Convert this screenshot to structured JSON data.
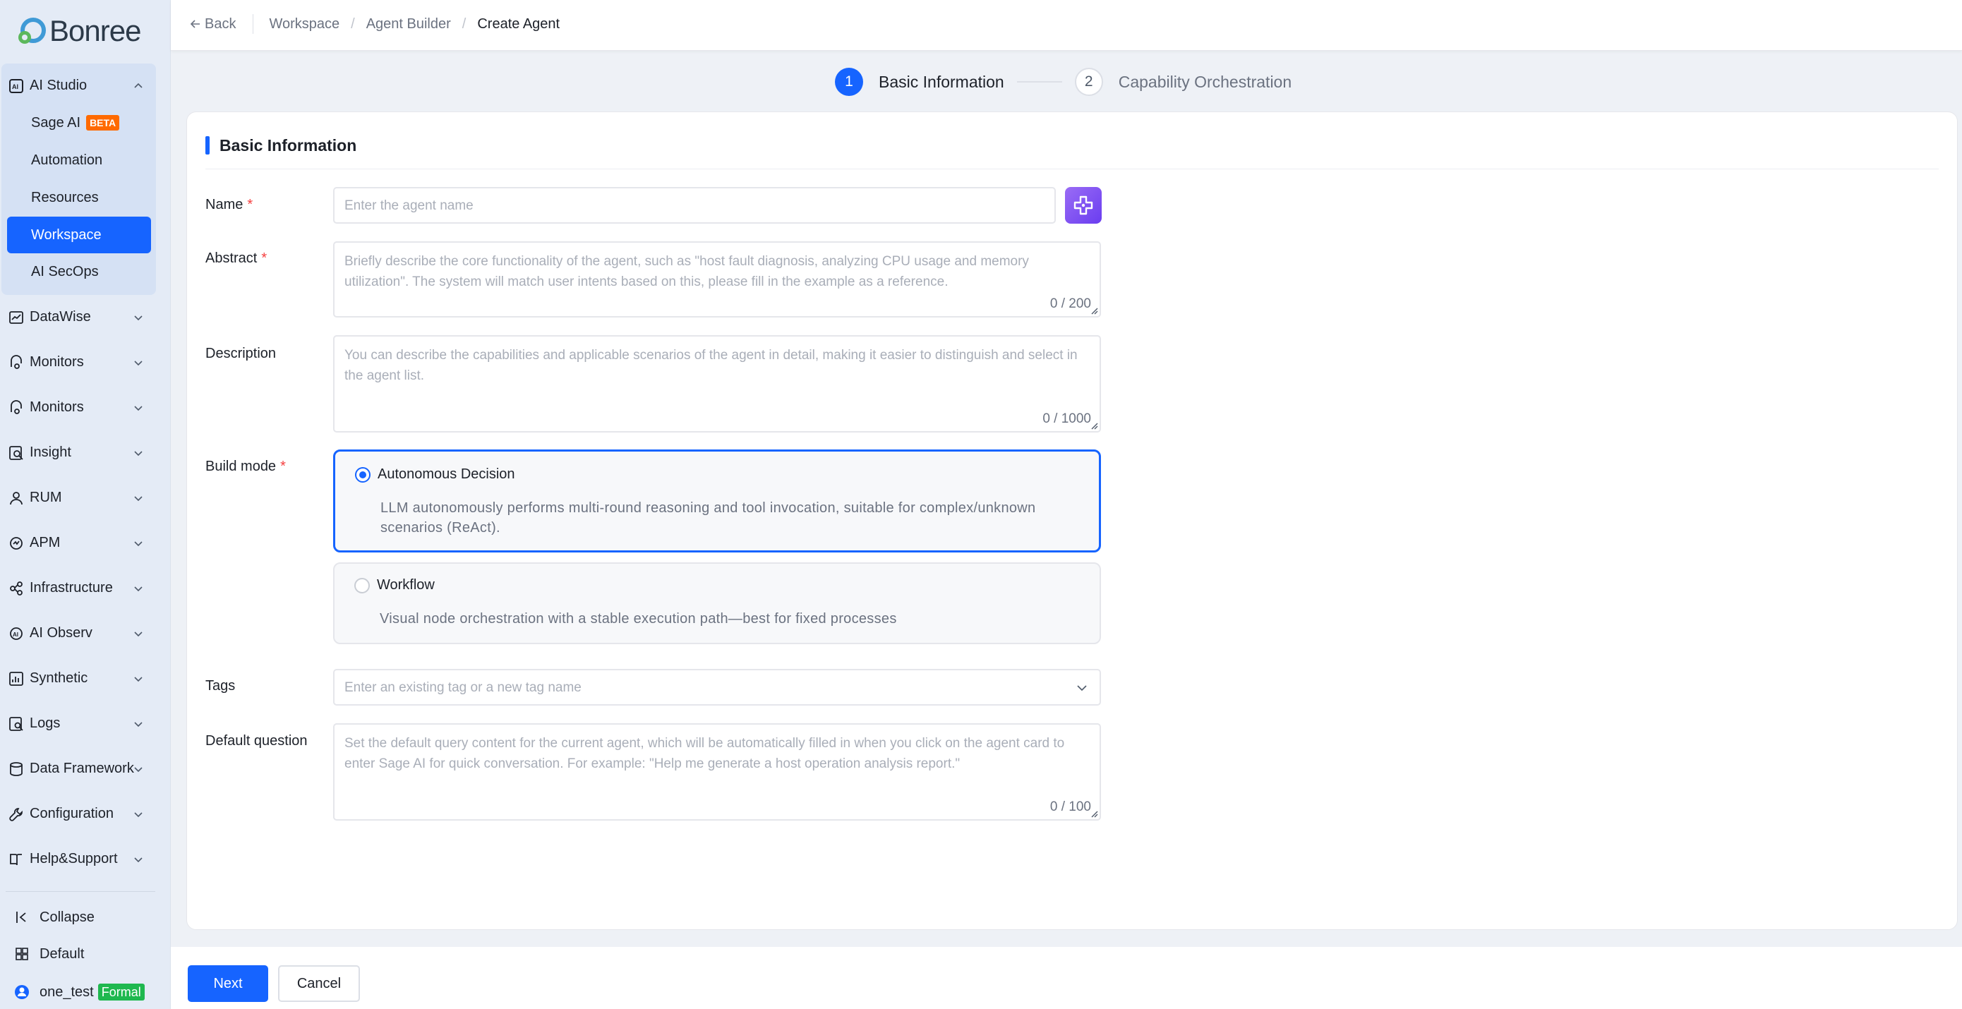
{
  "brand": {
    "name": "Bonree"
  },
  "sidebar": {
    "ai_studio": {
      "label": "AI Studio",
      "items": [
        {
          "label": "Sage AI",
          "badge": "BETA"
        },
        {
          "label": "Automation"
        },
        {
          "label": "Resources"
        },
        {
          "label": "Workspace"
        },
        {
          "label": "AI SecOps"
        }
      ]
    },
    "items": [
      {
        "label": "DataWise"
      },
      {
        "label": "Monitors"
      },
      {
        "label": "Monitors"
      },
      {
        "label": "Insight"
      },
      {
        "label": "RUM"
      },
      {
        "label": "APM"
      },
      {
        "label": "Infrastructure"
      },
      {
        "label": "AI Observ"
      },
      {
        "label": "Synthetic"
      },
      {
        "label": "Logs"
      },
      {
        "label": "Data Framework"
      },
      {
        "label": "Configuration"
      },
      {
        "label": "Help&Support"
      }
    ],
    "footer": {
      "collapse": "Collapse",
      "default": "Default",
      "user": "one_test",
      "env_badge": "Formal"
    }
  },
  "header": {
    "back": "Back",
    "breadcrumbs": [
      "Workspace",
      "Agent Builder",
      "Create Agent"
    ]
  },
  "steps": [
    {
      "num": "1",
      "label": "Basic Information"
    },
    {
      "num": "2",
      "label": "Capability Orchestration"
    }
  ],
  "form": {
    "section_title": "Basic Information",
    "name": {
      "label": "Name",
      "placeholder": "Enter the agent name"
    },
    "abstract": {
      "label": "Abstract",
      "placeholder": "Briefly describe the core functionality of the agent, such as \"host fault diagnosis, analyzing CPU usage and memory utilization\". The system will match user intents based on this, please fill in the example as a reference.",
      "counter": "0 / 200"
    },
    "description": {
      "label": "Description",
      "placeholder": "You can describe the capabilities and applicable scenarios of the agent in detail, making it easier to distinguish and select in the agent list.",
      "counter": "0 / 1000"
    },
    "build_mode": {
      "label": "Build mode",
      "options": [
        {
          "title": "Autonomous Decision",
          "desc": "LLM autonomously performs multi-round reasoning and tool invocation, suitable for complex/unknown scenarios (ReAct).",
          "selected": true
        },
        {
          "title": "Workflow",
          "desc": "Visual node orchestration with a stable execution path—best for fixed processes",
          "selected": false
        }
      ]
    },
    "tags": {
      "label": "Tags",
      "placeholder": "Enter an existing tag or a new tag name"
    },
    "default_question": {
      "label": "Default question",
      "placeholder": "Set the default query content for the current agent, which will be automatically filled in when you click on the agent card to enter Sage AI for quick conversation. For example: \"Help me generate a host operation analysis report.\"",
      "counter": "0 / 100"
    },
    "required_mark": "*"
  },
  "actions": {
    "next": "Next",
    "cancel": "Cancel"
  },
  "colors": {
    "primary": "#1664ff",
    "beta_badge": "#ff6a00",
    "formal_badge": "#1fb84f",
    "sidebar_bg": "#e4ebf6"
  }
}
